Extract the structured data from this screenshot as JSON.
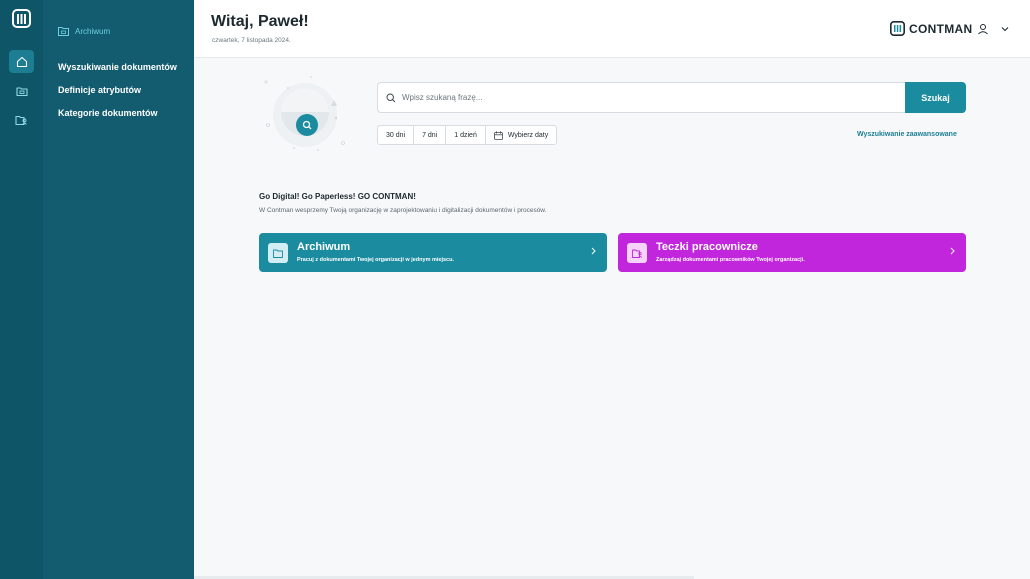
{
  "rail": {
    "items": [
      "home-icon",
      "archive-icon",
      "employee-files-icon"
    ],
    "active": 0
  },
  "sidebar": {
    "section_title": "Archiwum",
    "items": [
      {
        "label": "Wyszukiwanie dokumentów"
      },
      {
        "label": "Definicje atrybutów"
      },
      {
        "label": "Kategorie dokumentów"
      }
    ]
  },
  "header": {
    "greeting": "Witaj, Paweł!",
    "date": "czwartek, 7 listopada 2024.",
    "brand": "CONTMAN"
  },
  "search": {
    "placeholder": "Wpisz szukaną frazę...",
    "button_label": "Szukaj",
    "filters": [
      "30 dni",
      "7 dni",
      "1 dzień",
      "Wybierz daty"
    ],
    "advanced_label": "Wyszukiwanie zaawansowane"
  },
  "intro": {
    "title": "Go Digital! Go Paperless! GO CONTMAN!",
    "text": "W Contman wesprzemy Twoją organizację w zaprojektowaniu i digitalizacji dokumentów i procesów."
  },
  "cards": [
    {
      "title": "Archiwum",
      "subtitle": "Pracuj z dokumentami Twojej organizacji w jednym miejscu.",
      "color": "#1b8ba0"
    },
    {
      "title": "Teczki pracownicze",
      "subtitle": "Zarządzaj dokumentami pracowników Twojej organizacji.",
      "color": "#c226dc"
    }
  ],
  "colors": {
    "rail": "#0f5568",
    "sidebar": "#135b6e",
    "accent": "#1b8ba0",
    "accent_purple": "#c226dc"
  }
}
